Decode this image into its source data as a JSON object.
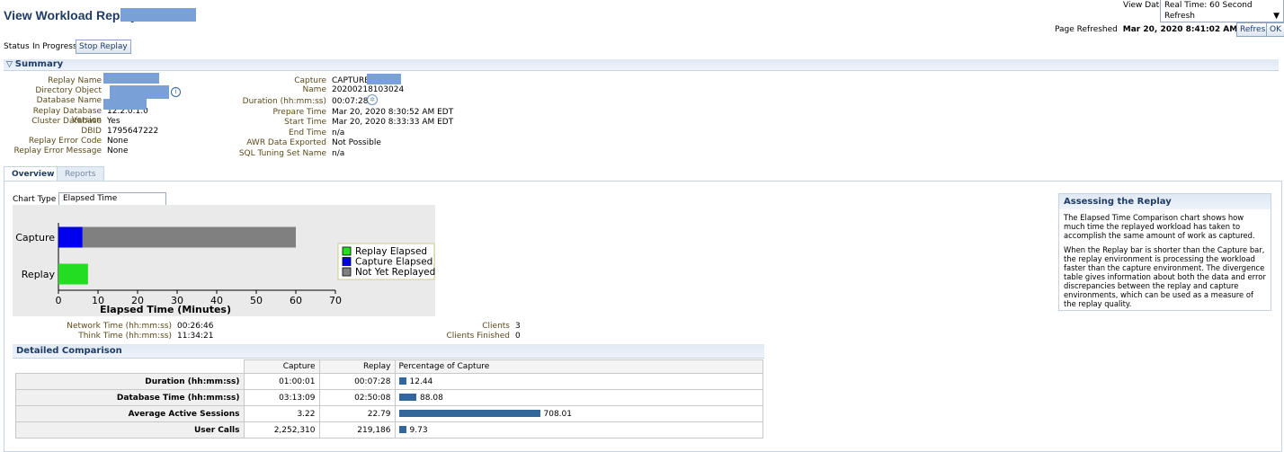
{
  "header": {
    "title": "View Workload Replay:",
    "view_data_label": "View Data",
    "view_data_value": "Real Time: 60 Second Refresh",
    "page_refreshed_label": "Page Refreshed",
    "page_refreshed_value": "Mar 20, 2020 8:41:02 AM EDT",
    "refresh_button": "Refresh",
    "ok_button": "OK"
  },
  "status": {
    "label": "Status",
    "value": "In Progress",
    "stop_button": "Stop Replay"
  },
  "summary": {
    "title": "Summary",
    "left": [
      {
        "label": "Replay Name",
        "value": ""
      },
      {
        "label": "Directory Object",
        "value": ""
      },
      {
        "label": "Database Name",
        "value": ""
      },
      {
        "label": "Replay Database Version",
        "value": "12.2.0.1.0"
      },
      {
        "label": "Cluster Database",
        "value": "Yes"
      },
      {
        "label": "DBID",
        "value": "1795647222"
      },
      {
        "label": "Replay Error Code",
        "value": "None"
      },
      {
        "label": "Replay Error Message",
        "value": "None"
      }
    ],
    "capture_name_label": "Capture Name",
    "capture_name_line1": "CAPTURE-",
    "capture_name_line2": "20200218103024",
    "right": [
      {
        "label": "Duration (hh:mm:ss)",
        "value": "00:07:28"
      },
      {
        "label": "Prepare Time",
        "value": "Mar 20, 2020 8:30:52 AM EDT"
      },
      {
        "label": "Start Time",
        "value": "Mar 20, 2020 8:33:33 AM EDT"
      },
      {
        "label": "End Time",
        "value": "n/a"
      },
      {
        "label": "AWR Data Exported",
        "value": "Not Possible"
      },
      {
        "label": "SQL Tuning Set Name",
        "value": "n/a"
      }
    ]
  },
  "tabs": [
    {
      "label": "Overview",
      "active": true
    },
    {
      "label": "Reports",
      "active": false
    }
  ],
  "chart_type": {
    "label": "Chart Type",
    "value": "Elapsed Time Comparison"
  },
  "chart_data": {
    "type": "bar",
    "orientation": "horizontal",
    "categories": [
      "Capture",
      "Replay"
    ],
    "series": [
      {
        "name": "Replay Elapsed",
        "color": "#22dd22",
        "values": [
          0,
          7.47
        ]
      },
      {
        "name": "Capture Elapsed",
        "color": "#0000ee",
        "values": [
          6.1,
          0
        ]
      },
      {
        "name": "Not Yet Replayed",
        "color": "#808080",
        "values": [
          53.9,
          0
        ]
      }
    ],
    "xlabel": "Elapsed Time (Minutes)",
    "xticks": [
      0,
      10,
      20,
      30,
      40,
      50,
      60,
      70
    ],
    "xlim": [
      0,
      70
    ],
    "legend": "right"
  },
  "stats": {
    "network_time_label": "Network Time (hh:mm:ss)",
    "network_time_value": "00:26:46",
    "think_time_label": "Think Time (hh:mm:ss)",
    "think_time_value": "11:34:21",
    "clients_label": "Clients",
    "clients_value": "3",
    "clients_finished_label": "Clients Finished",
    "clients_finished_value": "0"
  },
  "detailed": {
    "title": "Detailed Comparison",
    "columns": [
      "Capture",
      "Replay",
      "Percentage of Capture"
    ],
    "rows": [
      {
        "label": "Duration (hh:mm:ss)",
        "capture": "01:00:01",
        "replay": "00:07:28",
        "pct": "12.44",
        "pct_value": 12.44
      },
      {
        "label": "Database Time (hh:mm:ss)",
        "capture": "03:13:09",
        "replay": "02:50:08",
        "pct": "88.08",
        "pct_value": 88.08
      },
      {
        "label": "Average Active Sessions",
        "capture": "3.22",
        "replay": "22.79",
        "pct": "708.01",
        "pct_value": 708.01
      },
      {
        "label": "User Calls",
        "capture": "2,252,310",
        "replay": "219,186",
        "pct": "9.73",
        "pct_value": 9.73
      }
    ]
  },
  "assess": {
    "title": "Assessing the Replay",
    "p1": "The Elapsed Time Comparison chart shows how much time the replayed workload has taken to accomplish the same amount of work as captured.",
    "p2": "When the Replay bar is shorter than the Capture bar, the replay environment is processing the workload faster than the capture environment.  The divergence table gives information about both the data and error discrepancies between the replay and capture environments, which can be used as a measure of the replay quality."
  }
}
